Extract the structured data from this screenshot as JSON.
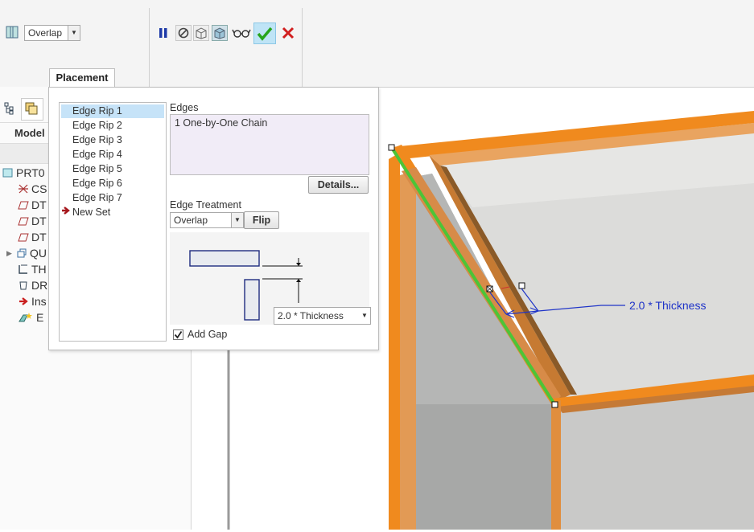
{
  "toolbar": {
    "treatment_select": "Overlap",
    "icons": [
      "pause-icon",
      "no-preview-icon",
      "wireframe-preview-icon",
      "shaded-preview-icon",
      "glasses-icon",
      "confirm-check-icon",
      "cancel-x-icon"
    ]
  },
  "tabs": {
    "placement": "Placement"
  },
  "model_tree": {
    "header": "Model",
    "items": [
      {
        "label": "PRT0",
        "icon": "part-icon"
      },
      {
        "label": "CS",
        "icon": "csys-icon"
      },
      {
        "label": "DT",
        "icon": "datum-plane-icon"
      },
      {
        "label": "DT",
        "icon": "datum-plane-icon"
      },
      {
        "label": "DT",
        "icon": "datum-plane-icon"
      },
      {
        "label": "QU",
        "icon": "quilt-icon"
      },
      {
        "label": "TH",
        "icon": "thicken-icon"
      },
      {
        "label": "DR",
        "icon": "draft-icon"
      },
      {
        "label": "Ins",
        "icon": "insert-arrow-icon"
      },
      {
        "label": "E",
        "icon": "edge-rip-icon"
      }
    ]
  },
  "panel": {
    "sets": [
      "Edge Rip 1",
      "Edge Rip 2",
      "Edge Rip 3",
      "Edge Rip 4",
      "Edge Rip 5",
      "Edge Rip 6",
      "Edge Rip 7"
    ],
    "selected_set": "Edge Rip 1",
    "new_set": "New Set",
    "edges_label": "Edges",
    "edges_value": "1 One-by-One Chain",
    "details_button": "Details...",
    "treatment_label": "Edge Treatment",
    "treatment_value": "Overlap",
    "flip_button": "Flip",
    "gap_value": "2.0 * Thickness",
    "add_gap_label": "Add Gap",
    "add_gap_checked": true
  },
  "graphics": {
    "dimension_label": "2.0 * Thickness"
  },
  "colors": {
    "accent_orange": "#f08a1e",
    "edge_green": "#4cc437",
    "selection_blue": "#c6e3f8",
    "dimension_blue": "#1f34c8"
  }
}
